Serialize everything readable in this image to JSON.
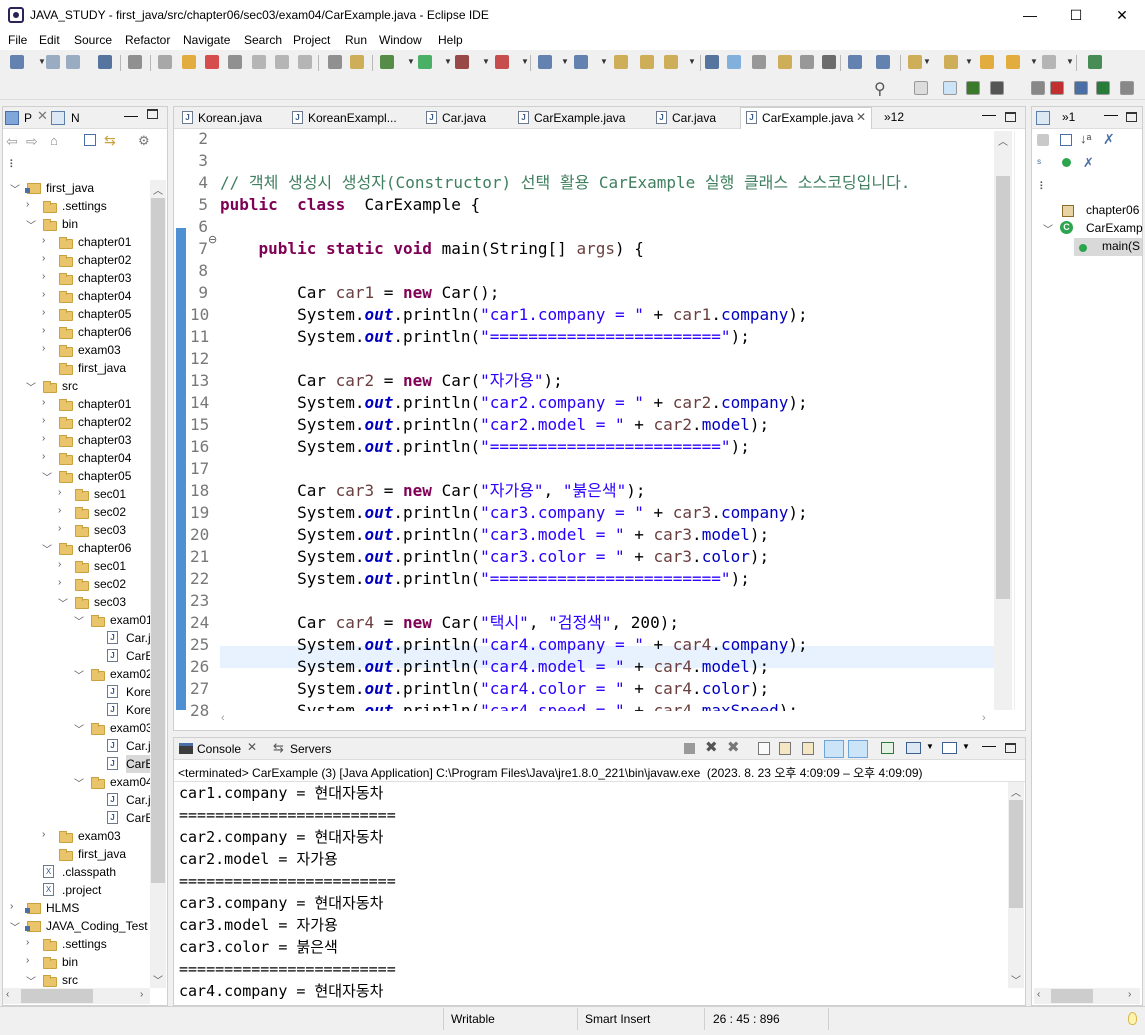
{
  "window": {
    "title": "JAVA_STUDY - first_java/src/chapter06/sec03/exam04/CarExample.java - Eclipse IDE",
    "min": "—",
    "max": "☐",
    "close": "✕"
  },
  "menu": [
    "File",
    "Edit",
    "Source",
    "Refactor",
    "Navigate",
    "Search",
    "Project",
    "Run",
    "Window",
    "Help"
  ],
  "left_tabs": {
    "tab1": "P",
    "tab2": "N"
  },
  "tree": [
    {
      "label": "first_java",
      "depth": 0,
      "exp": "open",
      "icon": "project"
    },
    {
      "label": ".settings",
      "depth": 1,
      "exp": "closed",
      "icon": "folder"
    },
    {
      "label": "bin",
      "depth": 1,
      "exp": "open",
      "icon": "folder"
    },
    {
      "label": "chapter01",
      "depth": 2,
      "exp": "closed",
      "icon": "folder"
    },
    {
      "label": "chapter02",
      "depth": 2,
      "exp": "closed",
      "icon": "folder"
    },
    {
      "label": "chapter03",
      "depth": 2,
      "exp": "closed",
      "icon": "folder"
    },
    {
      "label": "chapter04",
      "depth": 2,
      "exp": "closed",
      "icon": "folder"
    },
    {
      "label": "chapter05",
      "depth": 2,
      "exp": "closed",
      "icon": "folder"
    },
    {
      "label": "chapter06",
      "depth": 2,
      "exp": "closed",
      "icon": "folder"
    },
    {
      "label": "exam03",
      "depth": 2,
      "exp": "closed",
      "icon": "folder"
    },
    {
      "label": "first_java",
      "depth": 2,
      "exp": "none",
      "icon": "folder"
    },
    {
      "label": "src",
      "depth": 1,
      "exp": "open",
      "icon": "folder"
    },
    {
      "label": "chapter01",
      "depth": 2,
      "exp": "closed",
      "icon": "folder"
    },
    {
      "label": "chapter02",
      "depth": 2,
      "exp": "closed",
      "icon": "folder"
    },
    {
      "label": "chapter03",
      "depth": 2,
      "exp": "closed",
      "icon": "folder"
    },
    {
      "label": "chapter04",
      "depth": 2,
      "exp": "closed",
      "icon": "folder"
    },
    {
      "label": "chapter05",
      "depth": 2,
      "exp": "open",
      "icon": "folder"
    },
    {
      "label": "sec01",
      "depth": 3,
      "exp": "closed",
      "icon": "folder"
    },
    {
      "label": "sec02",
      "depth": 3,
      "exp": "closed",
      "icon": "folder"
    },
    {
      "label": "sec03",
      "depth": 3,
      "exp": "closed",
      "icon": "folder"
    },
    {
      "label": "chapter06",
      "depth": 2,
      "exp": "open",
      "icon": "folder"
    },
    {
      "label": "sec01",
      "depth": 3,
      "exp": "closed",
      "icon": "folder"
    },
    {
      "label": "sec02",
      "depth": 3,
      "exp": "closed",
      "icon": "folder"
    },
    {
      "label": "sec03",
      "depth": 3,
      "exp": "open",
      "icon": "folder"
    },
    {
      "label": "exam01",
      "depth": 4,
      "exp": "open",
      "icon": "folder"
    },
    {
      "label": "Car.j",
      "depth": 5,
      "exp": "none",
      "icon": "java"
    },
    {
      "label": "CarE",
      "depth": 5,
      "exp": "none",
      "icon": "java"
    },
    {
      "label": "exam02",
      "depth": 4,
      "exp": "open",
      "icon": "folder"
    },
    {
      "label": "Kore",
      "depth": 5,
      "exp": "none",
      "icon": "java"
    },
    {
      "label": "Kore",
      "depth": 5,
      "exp": "none",
      "icon": "java"
    },
    {
      "label": "exam03",
      "depth": 4,
      "exp": "open",
      "icon": "folder"
    },
    {
      "label": "Car.j",
      "depth": 5,
      "exp": "none",
      "icon": "java"
    },
    {
      "label": "CarE",
      "depth": 5,
      "exp": "none",
      "icon": "java",
      "selected": true
    },
    {
      "label": "exam04",
      "depth": 4,
      "exp": "open",
      "icon": "folder"
    },
    {
      "label": "Car.j",
      "depth": 5,
      "exp": "none",
      "icon": "java"
    },
    {
      "label": "CarE",
      "depth": 5,
      "exp": "none",
      "icon": "java"
    },
    {
      "label": "exam03",
      "depth": 2,
      "exp": "closed",
      "icon": "folder"
    },
    {
      "label": "first_java",
      "depth": 2,
      "exp": "none",
      "icon": "folder"
    },
    {
      "label": ".classpath",
      "depth": 1,
      "exp": "none",
      "icon": "xml"
    },
    {
      "label": ".project",
      "depth": 1,
      "exp": "none",
      "icon": "xml"
    },
    {
      "label": "HLMS",
      "depth": 0,
      "exp": "closed",
      "icon": "project"
    },
    {
      "label": "JAVA_Coding_Test",
      "depth": 0,
      "exp": "open",
      "icon": "project"
    },
    {
      "label": ".settings",
      "depth": 1,
      "exp": "closed",
      "icon": "folder"
    },
    {
      "label": "bin",
      "depth": 1,
      "exp": "closed",
      "icon": "folder"
    },
    {
      "label": "src",
      "depth": 1,
      "exp": "open",
      "icon": "folder"
    }
  ],
  "editor_tabs": [
    {
      "label": "Korean.java"
    },
    {
      "label": "KoreanExampl..."
    },
    {
      "label": "Car.java"
    },
    {
      "label": "CarExample.java"
    },
    {
      "label": "Car.java"
    },
    {
      "label": "CarExample.java",
      "active": true
    }
  ],
  "editor_overflow": "»12",
  "code": [
    {
      "n": "2",
      "t": []
    },
    {
      "n": "3",
      "t": []
    },
    {
      "n": "4",
      "t": [
        [
          "cmt",
          "// 객체 생성시 생성자(Constructor) 선택 활용 CarExample 실행 클래스 소스코딩입니다."
        ]
      ]
    },
    {
      "n": "5",
      "t": [
        [
          "kw",
          "public"
        ],
        [
          "",
          "  "
        ],
        [
          "kw",
          "class"
        ],
        [
          "",
          "  CarExample {"
        ]
      ]
    },
    {
      "n": "6",
      "t": []
    },
    {
      "n": "7",
      "t": [
        [
          "",
          "    "
        ],
        [
          "kw",
          "public"
        ],
        [
          "",
          " "
        ],
        [
          "kw",
          "static"
        ],
        [
          "",
          " "
        ],
        [
          "kw",
          "void"
        ],
        [
          "",
          " main(String[] "
        ],
        [
          "var",
          "args"
        ],
        [
          "",
          ") {"
        ]
      ]
    },
    {
      "n": "8",
      "t": []
    },
    {
      "n": "9",
      "t": [
        [
          "",
          "        Car "
        ],
        [
          "var",
          "car1"
        ],
        [
          "",
          " = "
        ],
        [
          "kw",
          "new"
        ],
        [
          "",
          " Car();"
        ]
      ]
    },
    {
      "n": "10",
      "t": [
        [
          "",
          "        System."
        ],
        [
          "sfld",
          "out"
        ],
        [
          "",
          ".println("
        ],
        [
          "str",
          "\"car1.company = \""
        ],
        [
          "",
          " + "
        ],
        [
          "var",
          "car1"
        ],
        [
          "",
          "."
        ],
        [
          "fld",
          "company"
        ],
        [
          "",
          ");"
        ]
      ]
    },
    {
      "n": "11",
      "t": [
        [
          "",
          "        System."
        ],
        [
          "sfld",
          "out"
        ],
        [
          "",
          ".println("
        ],
        [
          "str",
          "\"========================\""
        ],
        [
          "",
          ");"
        ]
      ]
    },
    {
      "n": "12",
      "t": []
    },
    {
      "n": "13",
      "t": [
        [
          "",
          "        Car "
        ],
        [
          "var",
          "car2"
        ],
        [
          "",
          " = "
        ],
        [
          "kw",
          "new"
        ],
        [
          "",
          " Car("
        ],
        [
          "str",
          "\"자가용\""
        ],
        [
          "",
          ");"
        ]
      ]
    },
    {
      "n": "14",
      "t": [
        [
          "",
          "        System."
        ],
        [
          "sfld",
          "out"
        ],
        [
          "",
          ".println("
        ],
        [
          "str",
          "\"car2.company = \""
        ],
        [
          "",
          " + "
        ],
        [
          "var",
          "car2"
        ],
        [
          "",
          "."
        ],
        [
          "fld",
          "company"
        ],
        [
          "",
          ");"
        ]
      ]
    },
    {
      "n": "15",
      "t": [
        [
          "",
          "        System."
        ],
        [
          "sfld",
          "out"
        ],
        [
          "",
          ".println("
        ],
        [
          "str",
          "\"car2.model = \""
        ],
        [
          "",
          " + "
        ],
        [
          "var",
          "car2"
        ],
        [
          "",
          "."
        ],
        [
          "fld",
          "model"
        ],
        [
          "",
          ");"
        ]
      ]
    },
    {
      "n": "16",
      "t": [
        [
          "",
          "        System."
        ],
        [
          "sfld",
          "out"
        ],
        [
          "",
          ".println("
        ],
        [
          "str",
          "\"========================\""
        ],
        [
          "",
          ");"
        ]
      ]
    },
    {
      "n": "17",
      "t": []
    },
    {
      "n": "18",
      "t": [
        [
          "",
          "        Car "
        ],
        [
          "var",
          "car3"
        ],
        [
          "",
          " = "
        ],
        [
          "kw",
          "new"
        ],
        [
          "",
          " Car("
        ],
        [
          "str",
          "\"자가용\""
        ],
        [
          "",
          ", "
        ],
        [
          "str",
          "\"붉은색\""
        ],
        [
          "",
          ");"
        ]
      ]
    },
    {
      "n": "19",
      "t": [
        [
          "",
          "        System."
        ],
        [
          "sfld",
          "out"
        ],
        [
          "",
          ".println("
        ],
        [
          "str",
          "\"car3.company = \""
        ],
        [
          "",
          " + "
        ],
        [
          "var",
          "car3"
        ],
        [
          "",
          "."
        ],
        [
          "fld",
          "company"
        ],
        [
          "",
          ");"
        ]
      ]
    },
    {
      "n": "20",
      "t": [
        [
          "",
          "        System."
        ],
        [
          "sfld",
          "out"
        ],
        [
          "",
          ".println("
        ],
        [
          "str",
          "\"car3.model = \""
        ],
        [
          "",
          " + "
        ],
        [
          "var",
          "car3"
        ],
        [
          "",
          "."
        ],
        [
          "fld",
          "model"
        ],
        [
          "",
          ");"
        ]
      ]
    },
    {
      "n": "21",
      "t": [
        [
          "",
          "        System."
        ],
        [
          "sfld",
          "out"
        ],
        [
          "",
          ".println("
        ],
        [
          "str",
          "\"car3.color = \""
        ],
        [
          "",
          " + "
        ],
        [
          "var",
          "car3"
        ],
        [
          "",
          "."
        ],
        [
          "fld",
          "color"
        ],
        [
          "",
          ");"
        ]
      ]
    },
    {
      "n": "22",
      "t": [
        [
          "",
          "        System."
        ],
        [
          "sfld",
          "out"
        ],
        [
          "",
          ".println("
        ],
        [
          "str",
          "\"========================\""
        ],
        [
          "",
          ");"
        ]
      ]
    },
    {
      "n": "23",
      "t": []
    },
    {
      "n": "24",
      "t": [
        [
          "",
          "        Car "
        ],
        [
          "var",
          "car4"
        ],
        [
          "",
          " = "
        ],
        [
          "kw",
          "new"
        ],
        [
          "",
          " Car("
        ],
        [
          "str",
          "\"택시\""
        ],
        [
          "",
          ", "
        ],
        [
          "str",
          "\"검정색\""
        ],
        [
          "",
          ", 200);"
        ]
      ]
    },
    {
      "n": "25",
      "t": [
        [
          "",
          "        System."
        ],
        [
          "sfld",
          "out"
        ],
        [
          "",
          ".println("
        ],
        [
          "str",
          "\"car4.company = \""
        ],
        [
          "",
          " + "
        ],
        [
          "var",
          "car4"
        ],
        [
          "",
          "."
        ],
        [
          "fld",
          "company"
        ],
        [
          "",
          ");"
        ]
      ]
    },
    {
      "n": "26",
      "t": [
        [
          "",
          "        System."
        ],
        [
          "sfld",
          "out"
        ],
        [
          "",
          ".println("
        ],
        [
          "str",
          "\"car4.model = \""
        ],
        [
          "",
          " + "
        ],
        [
          "var",
          "car4"
        ],
        [
          "",
          "."
        ],
        [
          "fld",
          "model"
        ],
        [
          "",
          ");"
        ]
      ],
      "current": true
    },
    {
      "n": "27",
      "t": [
        [
          "",
          "        System."
        ],
        [
          "sfld",
          "out"
        ],
        [
          "",
          ".println("
        ],
        [
          "str",
          "\"car4.color = \""
        ],
        [
          "",
          " + "
        ],
        [
          "var",
          "car4"
        ],
        [
          "",
          "."
        ],
        [
          "fld",
          "color"
        ],
        [
          "",
          ");"
        ]
      ]
    },
    {
      "n": "28",
      "t": [
        [
          "",
          "        System."
        ],
        [
          "sfld",
          "out"
        ],
        [
          "",
          ".println("
        ],
        [
          "str",
          "\"car4.speed = \""
        ],
        [
          "",
          " + "
        ],
        [
          "var",
          "car4"
        ],
        [
          "",
          "."
        ],
        [
          "fld",
          "maxSpeed"
        ],
        [
          "",
          ");"
        ]
      ]
    }
  ],
  "right_panel": {
    "outline_items": [
      {
        "label": "chapter06"
      },
      {
        "label": "CarExamp"
      },
      {
        "label": "main(S"
      }
    ],
    "overflow": "»1"
  },
  "console": {
    "tab": "Console",
    "servers_tab": "Servers",
    "status": "<terminated> CarExample (3) [Java Application] C:\\Program Files\\Java\\jre1.8.0_221\\bin\\javaw.exe  (2023. 8. 23 오후 4:09:09 – 오후 4:09:09)",
    "lines": [
      "car1.company = 현대자동차",
      "========================",
      "car2.company = 현대자동차",
      "car2.model = 자가용",
      "========================",
      "car3.company = 현대자동차",
      "car3.model = 자가용",
      "car3.color = 붉은색",
      "========================",
      "car4.company = 현대자동차"
    ]
  },
  "statusbar": {
    "writable": "Writable",
    "insert": "Smart Insert",
    "position": "26 : 45 : 896"
  }
}
